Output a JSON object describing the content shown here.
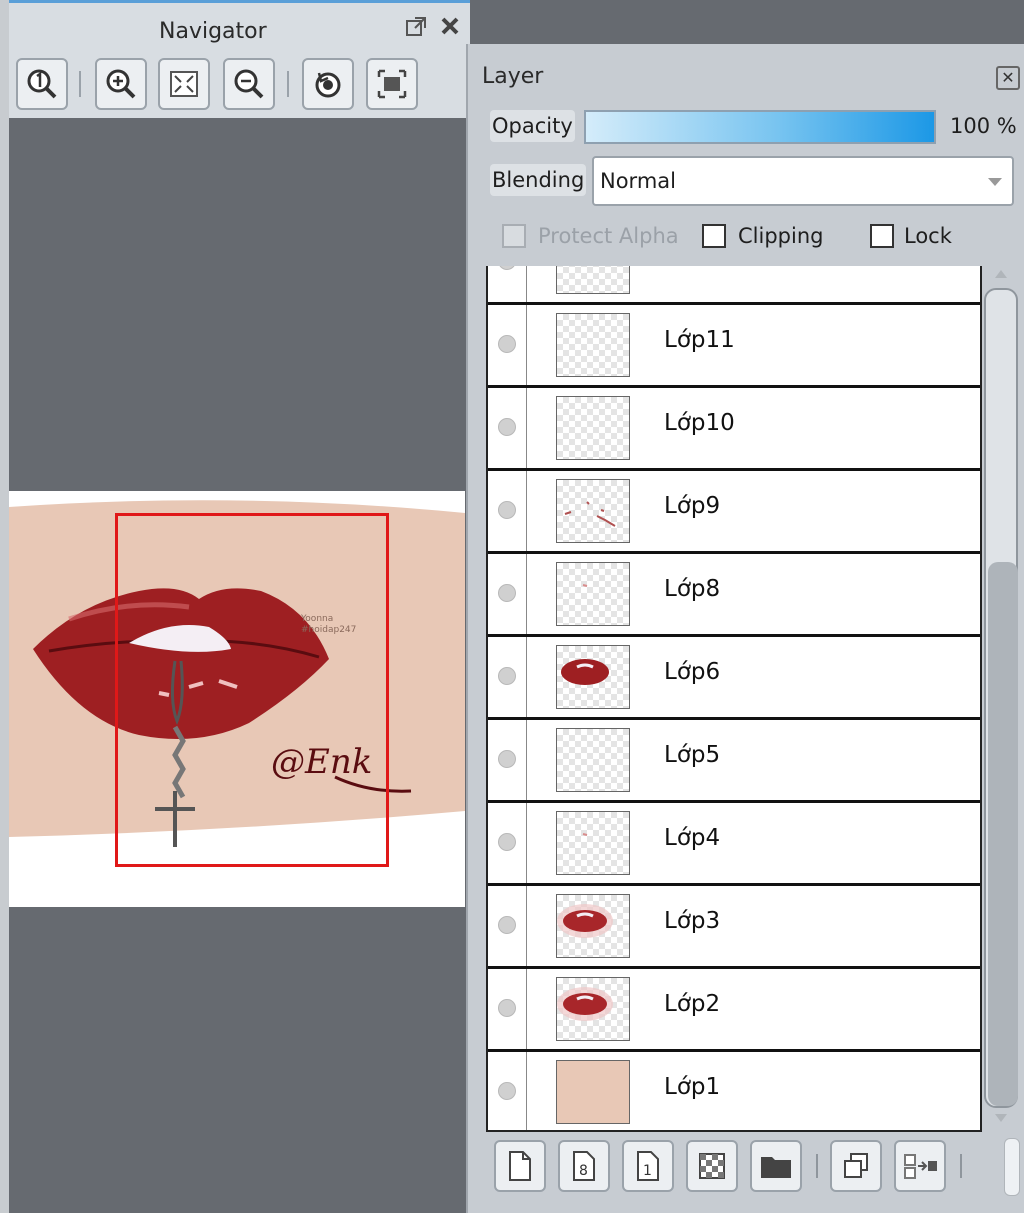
{
  "navigator": {
    "title": "Navigator",
    "icons": [
      "popout-icon",
      "close-icon",
      "zoom-actual-icon",
      "zoom-in-icon",
      "fit-screen-icon",
      "zoom-out-icon",
      "rotate-reset-icon",
      "fit-window-icon"
    ],
    "preview_text": {
      "watermark_line1": "Yoonna",
      "watermark_line2": "#hoidap247",
      "signature": "@Enk"
    }
  },
  "layer_panel": {
    "title": "Layer",
    "opacity_label": "Opacity",
    "opacity_value": "100 %",
    "opacity_fraction": 1.0,
    "blending_label": "Blending",
    "blending_value": "Normal",
    "protect_alpha_label": "Protect Alpha",
    "clipping_label": "Clipping",
    "lock_label": "Lock",
    "layers": [
      {
        "name": "Lớp11",
        "thumb": "empty"
      },
      {
        "name": "Lớp10",
        "thumb": "empty"
      },
      {
        "name": "Lớp9",
        "thumb": "specks"
      },
      {
        "name": "Lớp8",
        "thumb": "speck"
      },
      {
        "name": "Lớp6",
        "thumb": "lips"
      },
      {
        "name": "Lớp5",
        "thumb": "empty"
      },
      {
        "name": "Lớp4",
        "thumb": "speck"
      },
      {
        "name": "Lớp3",
        "thumb": "lips-soft"
      },
      {
        "name": "Lớp2",
        "thumb": "lips-soft"
      },
      {
        "name": "Lớp1",
        "thumb": "solid"
      }
    ],
    "bottom_icons": [
      "new-raster-layer-icon",
      "new-8bit-layer-icon",
      "new-1bit-layer-icon",
      "new-halftone-layer-icon",
      "new-folder-icon",
      "duplicate-layer-icon",
      "merge-down-icon"
    ]
  },
  "colors": {
    "accent": "#1c98e6",
    "selection_rect": "#e01818",
    "lip_red": "#9e1f22",
    "skin": "#e8c8b6"
  }
}
